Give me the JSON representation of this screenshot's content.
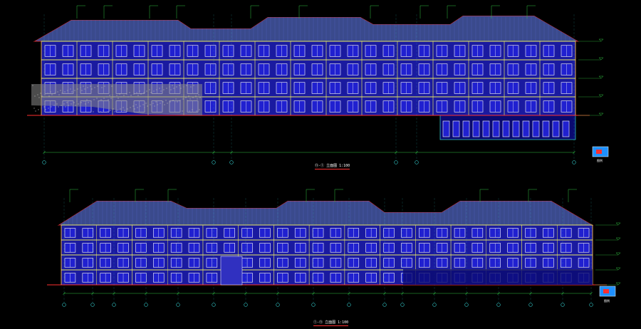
{
  "drawing": {
    "background": "#000000",
    "colors": {
      "roof": "#3a4a8c",
      "roof_line": "#5a6ad0",
      "facade": "#1a1aa0",
      "facade_dark": "#0a0a70",
      "trim": "#e8e860",
      "window": "#ffffff",
      "glass": "#2020d0",
      "outline": "#ff3030",
      "grid": "#30c0c0",
      "dim": "#30c040",
      "hatch": "#b0b0b0",
      "text": "#ffffff"
    },
    "elevations": [
      {
        "id": "elev-top",
        "title_numbers": [
          "⑪",
          "①"
        ],
        "title_text": "立面图",
        "scale": "1:100"
      },
      {
        "id": "elev-bottom",
        "title_numbers": [
          "①",
          "⑪"
        ],
        "title_text": "立面图",
        "scale": "1:100"
      }
    ],
    "stamp_label": "图例"
  }
}
